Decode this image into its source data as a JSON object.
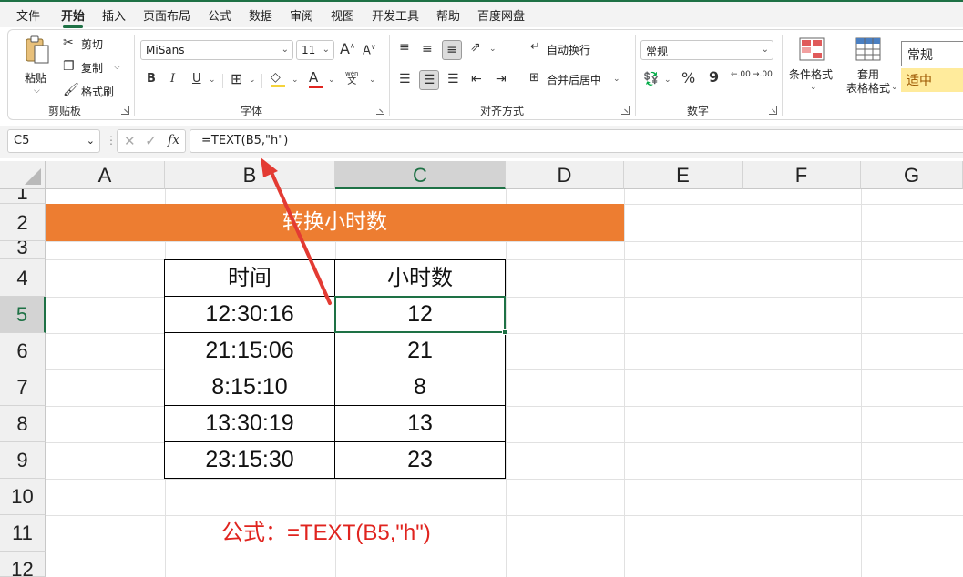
{
  "menu": {
    "items": [
      "文件",
      "开始",
      "插入",
      "页面布局",
      "公式",
      "数据",
      "审阅",
      "视图",
      "开发工具",
      "帮助",
      "百度网盘"
    ],
    "active": "开始"
  },
  "ribbon": {
    "clipboard": {
      "paste": "粘贴",
      "cut": "剪切",
      "copy": "复制",
      "format_painter": "格式刷",
      "label": "剪贴板"
    },
    "font": {
      "name": "MiSans",
      "size": "11",
      "bold": "B",
      "italic": "I",
      "underline": "U",
      "label": "字体",
      "grow": "A",
      "shrink": "A",
      "phonetic_top": "wén",
      "phonetic_bottom": "文",
      "font_color": "A"
    },
    "alignment": {
      "wrap": "自动换行",
      "merge": "合并后居中",
      "label": "对齐方式"
    },
    "number": {
      "format": "常规",
      "percent": "%",
      "comma": "9",
      "inc_decimal": ".00",
      "dec_decimal": ".00",
      "label": "数字"
    },
    "styles": {
      "conditional": "条件格式",
      "table_format_line1": "套用",
      "table_format_line2": "表格格式",
      "style_normal": "常规",
      "style_neutral": "适中"
    }
  },
  "formula_bar": {
    "name_box": "C5",
    "formula": "=TEXT(B5,\"h\")",
    "fx": "fx"
  },
  "grid": {
    "columns": [
      "A",
      "B",
      "C",
      "D",
      "E",
      "F",
      "G"
    ],
    "selected_column": "C",
    "rows": [
      "1",
      "2",
      "3",
      "4",
      "5",
      "6",
      "7",
      "8",
      "9",
      "10",
      "11",
      "12"
    ],
    "selected_row": "5"
  },
  "sheet": {
    "title": "转换小时数",
    "title_color": "#ED7D31",
    "table_headers": [
      "时间",
      "小时数"
    ],
    "table_rows": [
      [
        "12:30:16",
        "12"
      ],
      [
        "21:15:06",
        "21"
      ],
      [
        "8:15:10",
        "8"
      ],
      [
        "13:30:19",
        "13"
      ],
      [
        "23:15:30",
        "23"
      ]
    ],
    "note": "公式：=TEXT(B5,\"h\")",
    "note_color": "#E0241F",
    "accent_color": "#1E7145"
  }
}
